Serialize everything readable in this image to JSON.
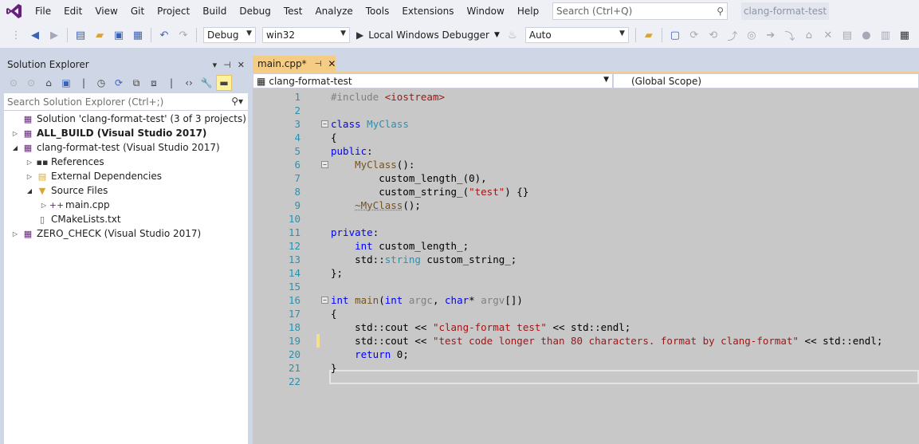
{
  "menubar": {
    "items": [
      "File",
      "Edit",
      "View",
      "Git",
      "Project",
      "Build",
      "Debug",
      "Test",
      "Analyze",
      "Tools",
      "Extensions",
      "Window",
      "Help"
    ],
    "search_placeholder": "Search (Ctrl+Q)",
    "solution_title": "clang-format-test"
  },
  "toolbar": {
    "config": "Debug",
    "platform": "win32",
    "run_label": "Local Windows Debugger",
    "solution_config": "Auto"
  },
  "solution_explorer": {
    "title": "Solution Explorer",
    "search_placeholder": "Search Solution Explorer (Ctrl+;)",
    "tree": [
      {
        "label": "Solution 'clang-format-test' (3 of 3 projects)",
        "indent": 0,
        "expander": "",
        "icon": "solution-icon",
        "bold": false
      },
      {
        "label": "ALL_BUILD (Visual Studio 2017)",
        "indent": 0,
        "expander": "collapsed",
        "icon": "project-icon",
        "bold": true
      },
      {
        "label": "clang-format-test (Visual Studio 2017)",
        "indent": 0,
        "expander": "expanded",
        "icon": "project-icon",
        "bold": false
      },
      {
        "label": "References",
        "indent": 1,
        "expander": "collapsed",
        "icon": "references-icon",
        "bold": false
      },
      {
        "label": "External Dependencies",
        "indent": 1,
        "expander": "collapsed",
        "icon": "external-deps-icon",
        "bold": false
      },
      {
        "label": "Source Files",
        "indent": 1,
        "expander": "expanded",
        "icon": "filter-folder-icon",
        "bold": false
      },
      {
        "label": "main.cpp",
        "indent": 2,
        "expander": "collapsed",
        "icon": "cpp-file-icon",
        "bold": false
      },
      {
        "label": "CMakeLists.txt",
        "indent": 1,
        "expander": "",
        "icon": "text-file-icon",
        "bold": false
      },
      {
        "label": "ZERO_CHECK (Visual Studio 2017)",
        "indent": 0,
        "expander": "collapsed",
        "icon": "project-icon",
        "bold": false
      }
    ]
  },
  "editor": {
    "tab_label": "main.cpp*",
    "project_scope": "clang-format-test",
    "global_scope": "(Global Scope)",
    "lines": [
      {
        "n": "1",
        "html": "<span class=\"pp\">#include</span> <span class=\"inc\">&lt;iostream&gt;</span>"
      },
      {
        "n": "2",
        "html": ""
      },
      {
        "n": "3",
        "html": "<span class=\"kw\">class</span> <span class=\"ty\">MyClass</span>",
        "fold": true
      },
      {
        "n": "4",
        "html": "{"
      },
      {
        "n": "5",
        "html": "<span class=\"kw\">public</span>:"
      },
      {
        "n": "6",
        "html": "    <span class=\"fn\">MyClass</span>():",
        "fold": true
      },
      {
        "n": "7",
        "html": "        custom_length_(0),"
      },
      {
        "n": "8",
        "html": "        custom_string_(<span class=\"str\">\"test\"</span>) {}"
      },
      {
        "n": "9",
        "html": "    <span class=\"fn squig\">~MyClass</span>();"
      },
      {
        "n": "10",
        "html": ""
      },
      {
        "n": "11",
        "html": "<span class=\"kw\">private</span>:"
      },
      {
        "n": "12",
        "html": "    <span class=\"kw\">int</span> custom_length_;"
      },
      {
        "n": "13",
        "html": "    std::<span class=\"ty\">string</span> custom_string_;"
      },
      {
        "n": "14",
        "html": "};"
      },
      {
        "n": "15",
        "html": ""
      },
      {
        "n": "16",
        "html": "<span class=\"kw\">int</span> <span class=\"fn\">main</span>(<span class=\"kw\">int</span> <span class=\"pr\">argc</span>, <span class=\"kw\">char</span>* <span class=\"pr\">argv</span>[])",
        "fold": true
      },
      {
        "n": "17",
        "html": "{"
      },
      {
        "n": "18",
        "html": "    std::cout &lt;&lt; <span class=\"str\">\"clang-format test\"</span> &lt;&lt; std::endl;"
      },
      {
        "n": "19",
        "html": "    std::cout &lt;&lt; <span class=\"str\">\"test code longer than 80 characters. format by clang-format\"</span> &lt;&lt; std::endl;",
        "changed": true
      },
      {
        "n": "20",
        "html": "    <span class=\"kw\">return</span> 0;"
      },
      {
        "n": "21",
        "html": "}"
      },
      {
        "n": "22",
        "html": ""
      }
    ]
  }
}
